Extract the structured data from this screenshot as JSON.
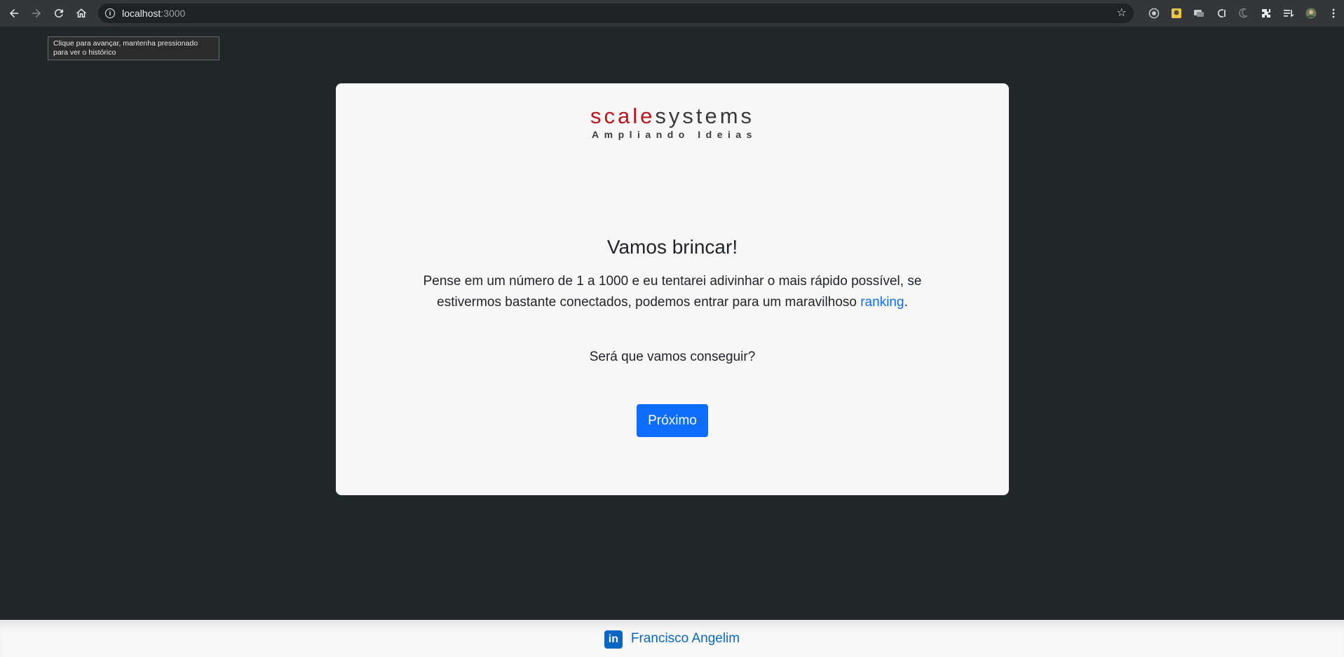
{
  "browser": {
    "url_host": "localhost",
    "url_port": ":3000",
    "tooltip": "Clique para avançar, mantenha pressionado para ver o histórico"
  },
  "card": {
    "logo_part1": "scale",
    "logo_part2": "systems",
    "logo_tagline": "Ampliando Ideias",
    "title": "Vamos brincar!",
    "lead_text": "Pense em um número de 1 a 1000 e eu tentarei adivinhar o mais rápido possível, se estivermos bastante conectados, podemos entrar para um maravilhoso",
    "lead_link": "ranking",
    "lead_end": ".",
    "question": "Será que vamos conseguir?",
    "next_button": "Próximo"
  },
  "footer": {
    "author": "Francisco Angelim",
    "icon_text": "in"
  },
  "colors": {
    "background": "#202728",
    "primary": "#0d6efd",
    "logo_red": "#c1131a",
    "linkedin": "#0a66c2"
  }
}
